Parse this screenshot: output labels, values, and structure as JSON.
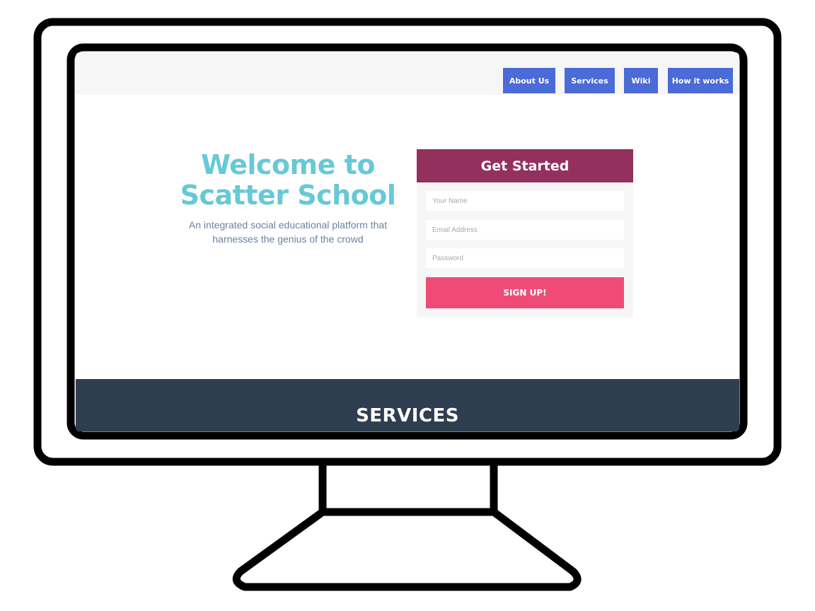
{
  "nav": {
    "items": [
      {
        "label": "About Us"
      },
      {
        "label": "Services"
      },
      {
        "label": "Wiki"
      },
      {
        "label": "How it works"
      }
    ]
  },
  "hero": {
    "title": "Welcome to Scatter School",
    "subtitle": "An integrated social educational platform that harnesses the genius of the crowd"
  },
  "signup_form": {
    "heading": "Get Started",
    "name_placeholder": "Your Name",
    "name_value": "",
    "email_placeholder": "Email Address",
    "email_value": "",
    "password_placeholder": "Password",
    "password_value": "",
    "submit_label": "SIGN UP!"
  },
  "services": {
    "heading": "SERVICES"
  },
  "colors": {
    "nav_button": "#4a6bd8",
    "hero_title": "#66c9d6",
    "hero_subtitle": "#6c82a0",
    "form_header": "#93305e",
    "signup_button": "#f04b77",
    "services_band": "#2e3e50"
  }
}
